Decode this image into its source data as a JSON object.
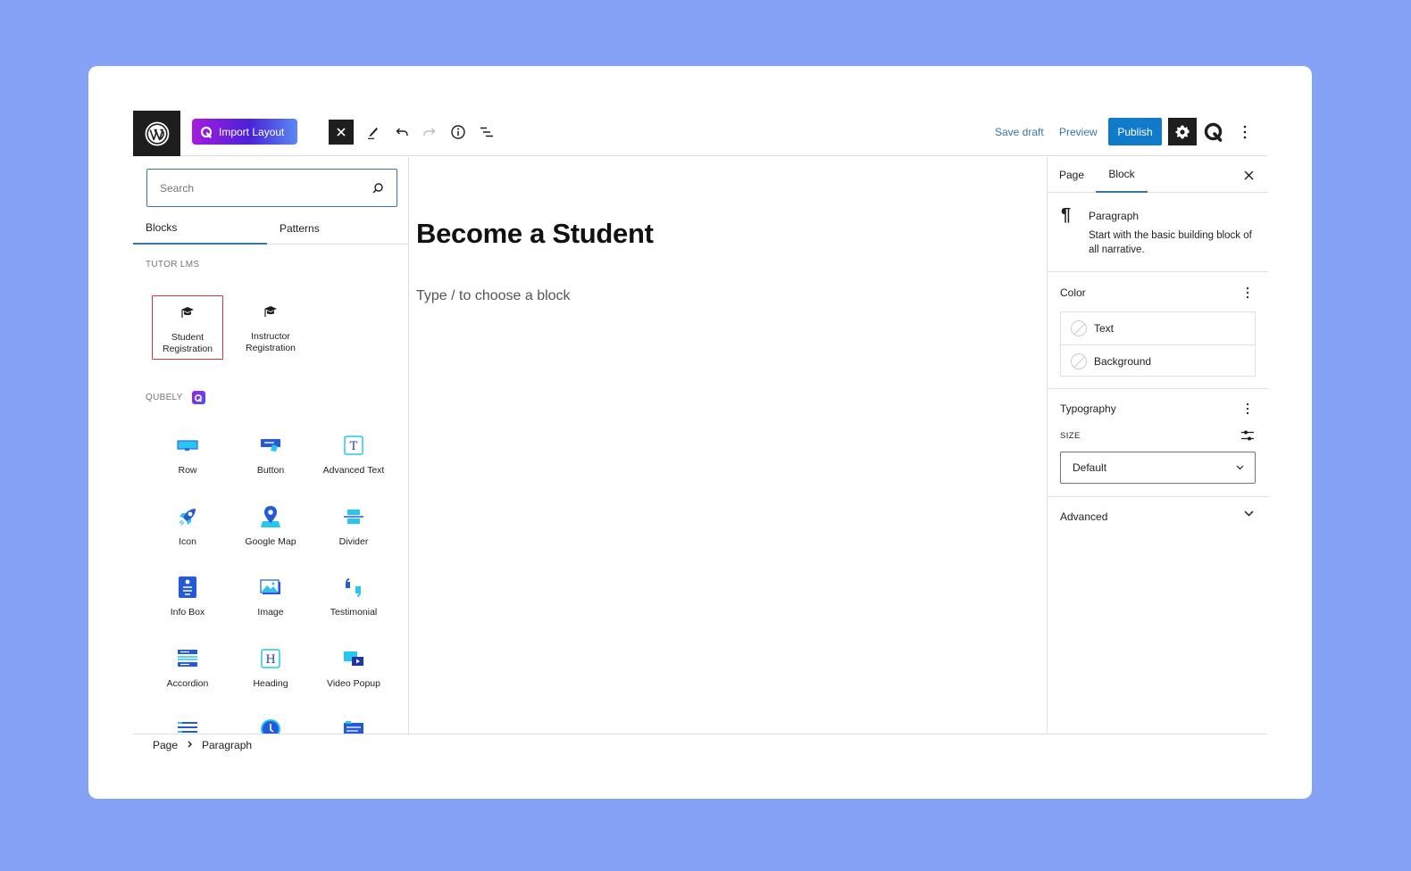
{
  "toolbar": {
    "import_layout_label": "Import Layout",
    "save_draft_label": "Save draft",
    "preview_label": "Preview",
    "publish_label": "Publish"
  },
  "inserter": {
    "search_placeholder": "Search",
    "tabs": [
      {
        "label": "Blocks",
        "active": true
      },
      {
        "label": "Patterns",
        "active": false
      }
    ],
    "categories": [
      {
        "label": "TUTOR LMS",
        "blocks": [
          {
            "label": "Student Registration",
            "icon": "graduation-cap-icon",
            "selected": true
          },
          {
            "label": "Instructor Registration",
            "icon": "graduation-cap-icon",
            "selected": false
          }
        ]
      },
      {
        "label": "QUBELY",
        "blocks": [
          {
            "label": "Row",
            "icon": "row-icon"
          },
          {
            "label": "Button",
            "icon": "button-icon"
          },
          {
            "label": "Advanced Text",
            "icon": "advanced-text-icon"
          },
          {
            "label": "Icon",
            "icon": "rocket-icon"
          },
          {
            "label": "Google Map",
            "icon": "map-pin-icon"
          },
          {
            "label": "Divider",
            "icon": "divider-icon"
          },
          {
            "label": "Info Box",
            "icon": "info-box-icon"
          },
          {
            "label": "Image",
            "icon": "image-icon"
          },
          {
            "label": "Testimonial",
            "icon": "quote-icon"
          },
          {
            "label": "Accordion",
            "icon": "accordion-icon"
          },
          {
            "label": "Heading",
            "icon": "heading-icon"
          },
          {
            "label": "Video Popup",
            "icon": "video-popup-icon"
          }
        ]
      }
    ],
    "selection_color": "#d63638"
  },
  "canvas": {
    "title": "Become a Student",
    "placeholder": "Type / to choose a block"
  },
  "sidebar": {
    "tabs": [
      {
        "label": "Page",
        "active": false
      },
      {
        "label": "Block",
        "active": true
      }
    ],
    "block_card": {
      "title": "Paragraph",
      "description": "Start with the basic building block of all narrative."
    },
    "color_panel": {
      "title": "Color",
      "items": [
        {
          "label": "Text"
        },
        {
          "label": "Background"
        }
      ]
    },
    "typography_panel": {
      "title": "Typography",
      "size_label": "SIZE",
      "size_value": "Default"
    },
    "advanced_panel": {
      "title": "Advanced"
    }
  },
  "breadcrumb": {
    "items": [
      "Page",
      "Paragraph"
    ]
  },
  "colors": {
    "background": "#85a2f6",
    "accent": "#3a74a8",
    "publish": "#117ac9",
    "dark": "#1e1e1e"
  }
}
